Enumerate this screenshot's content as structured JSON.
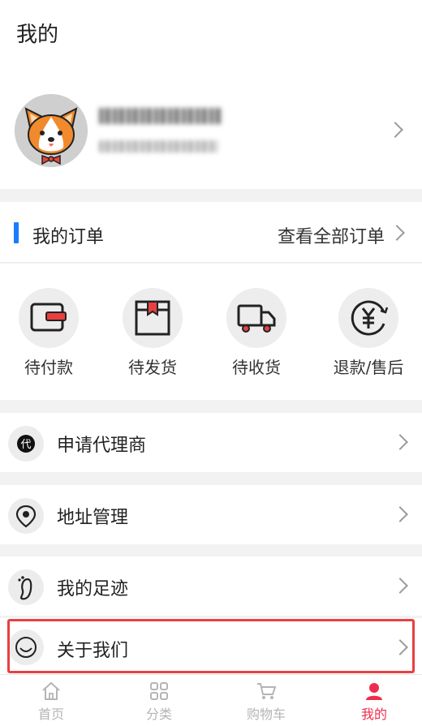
{
  "page": {
    "title": "我的"
  },
  "orders": {
    "title": "我的订单",
    "view_all": "查看全部订单",
    "items": [
      {
        "label": "待付款",
        "icon": "wallet-icon"
      },
      {
        "label": "待发货",
        "icon": "box-icon"
      },
      {
        "label": "待收货",
        "icon": "truck-icon"
      },
      {
        "label": "退款/售后",
        "icon": "yen-refund-icon"
      }
    ]
  },
  "menu": [
    {
      "label": "申请代理商",
      "icon": "agent-icon"
    },
    {
      "label": "地址管理",
      "icon": "location-icon"
    },
    {
      "label": "我的足迹",
      "icon": "footprint-icon"
    },
    {
      "label": "关于我们",
      "icon": "smile-icon"
    }
  ],
  "tabbar": [
    {
      "label": "首页",
      "icon": "home-icon"
    },
    {
      "label": "分类",
      "icon": "category-icon"
    },
    {
      "label": "购物车",
      "icon": "cart-icon"
    },
    {
      "label": "我的",
      "icon": "user-icon",
      "active": true
    }
  ],
  "colors": {
    "accent_blue": "#1a7cff",
    "active_tab": "#ee2d4c",
    "highlight": "#e84040"
  }
}
